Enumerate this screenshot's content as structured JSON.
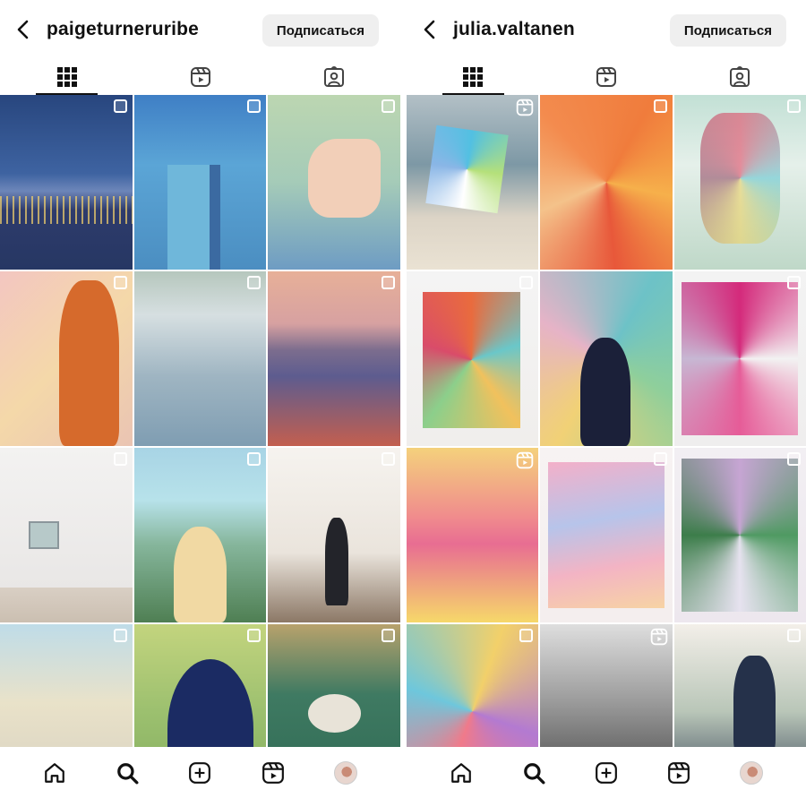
{
  "panels": [
    {
      "username": "paigeturneruribe",
      "follow_label": "Подписаться",
      "tabs": [
        {
          "icon": "grid-icon",
          "active": true
        },
        {
          "icon": "reels-icon",
          "active": false
        },
        {
          "icon": "tagged-icon",
          "active": false
        }
      ],
      "posts": [
        {
          "subject": "figures overlooking city lights at dusk",
          "badge": "multi-post"
        },
        {
          "subject": "blue building with palm trees",
          "badge": "multi-post"
        },
        {
          "subject": "legs reading a book on a chair",
          "badge": "multi-post"
        },
        {
          "subject": "red-haired woman holding a mirror",
          "badge": "multi-post"
        },
        {
          "subject": "sea waves",
          "badge": "multi-post"
        },
        {
          "subject": "sunset over mountain and city",
          "badge": "multi-post"
        },
        {
          "subject": "two small paintings on gallery wall",
          "badge": "multi-post"
        },
        {
          "subject": "woman with plant over hillside houses",
          "badge": "multi-post"
        },
        {
          "subject": "artist seated in studio",
          "badge": "multi-post"
        },
        {
          "subject": "castle with trees",
          "badge": "multi-post"
        },
        {
          "subject": "black cat in grass",
          "badge": "multi-post"
        },
        {
          "subject": "people at table in garden",
          "badge": "multi-post"
        }
      ]
    },
    {
      "username": "julia.valtanen",
      "follow_label": "Подписаться",
      "tabs": [
        {
          "icon": "grid-icon",
          "active": true
        },
        {
          "icon": "reels-icon",
          "active": false
        },
        {
          "icon": "tagged-icon",
          "active": false
        }
      ],
      "posts": [
        {
          "subject": "painting standing on beach",
          "badge": "reel"
        },
        {
          "subject": "orange abstract painting",
          "badge": "multi-post"
        },
        {
          "subject": "abstract collage with flowers",
          "badge": "multi-post"
        },
        {
          "subject": "colorful abstract canvas",
          "badge": "multi-post"
        },
        {
          "subject": "artist seated before large painting",
          "badge": "none"
        },
        {
          "subject": "magenta abstract painting",
          "badge": "multi-post"
        },
        {
          "subject": "pink and yellow abstract waves",
          "badge": "reel"
        },
        {
          "subject": "pastel drip painting",
          "badge": "multi-post"
        },
        {
          "subject": "green and lilac abstract collage",
          "badge": "multi-post"
        },
        {
          "subject": "bright abstract detail",
          "badge": "multi-post"
        },
        {
          "subject": "studio light and shadow",
          "badge": "reel"
        },
        {
          "subject": "artist painting on floor",
          "badge": "multi-post"
        }
      ]
    }
  ],
  "bottom_nav": [
    {
      "icon": "home-icon"
    },
    {
      "icon": "search-icon"
    },
    {
      "icon": "create-icon"
    },
    {
      "icon": "reels-icon"
    },
    {
      "icon": "profile-avatar"
    }
  ]
}
